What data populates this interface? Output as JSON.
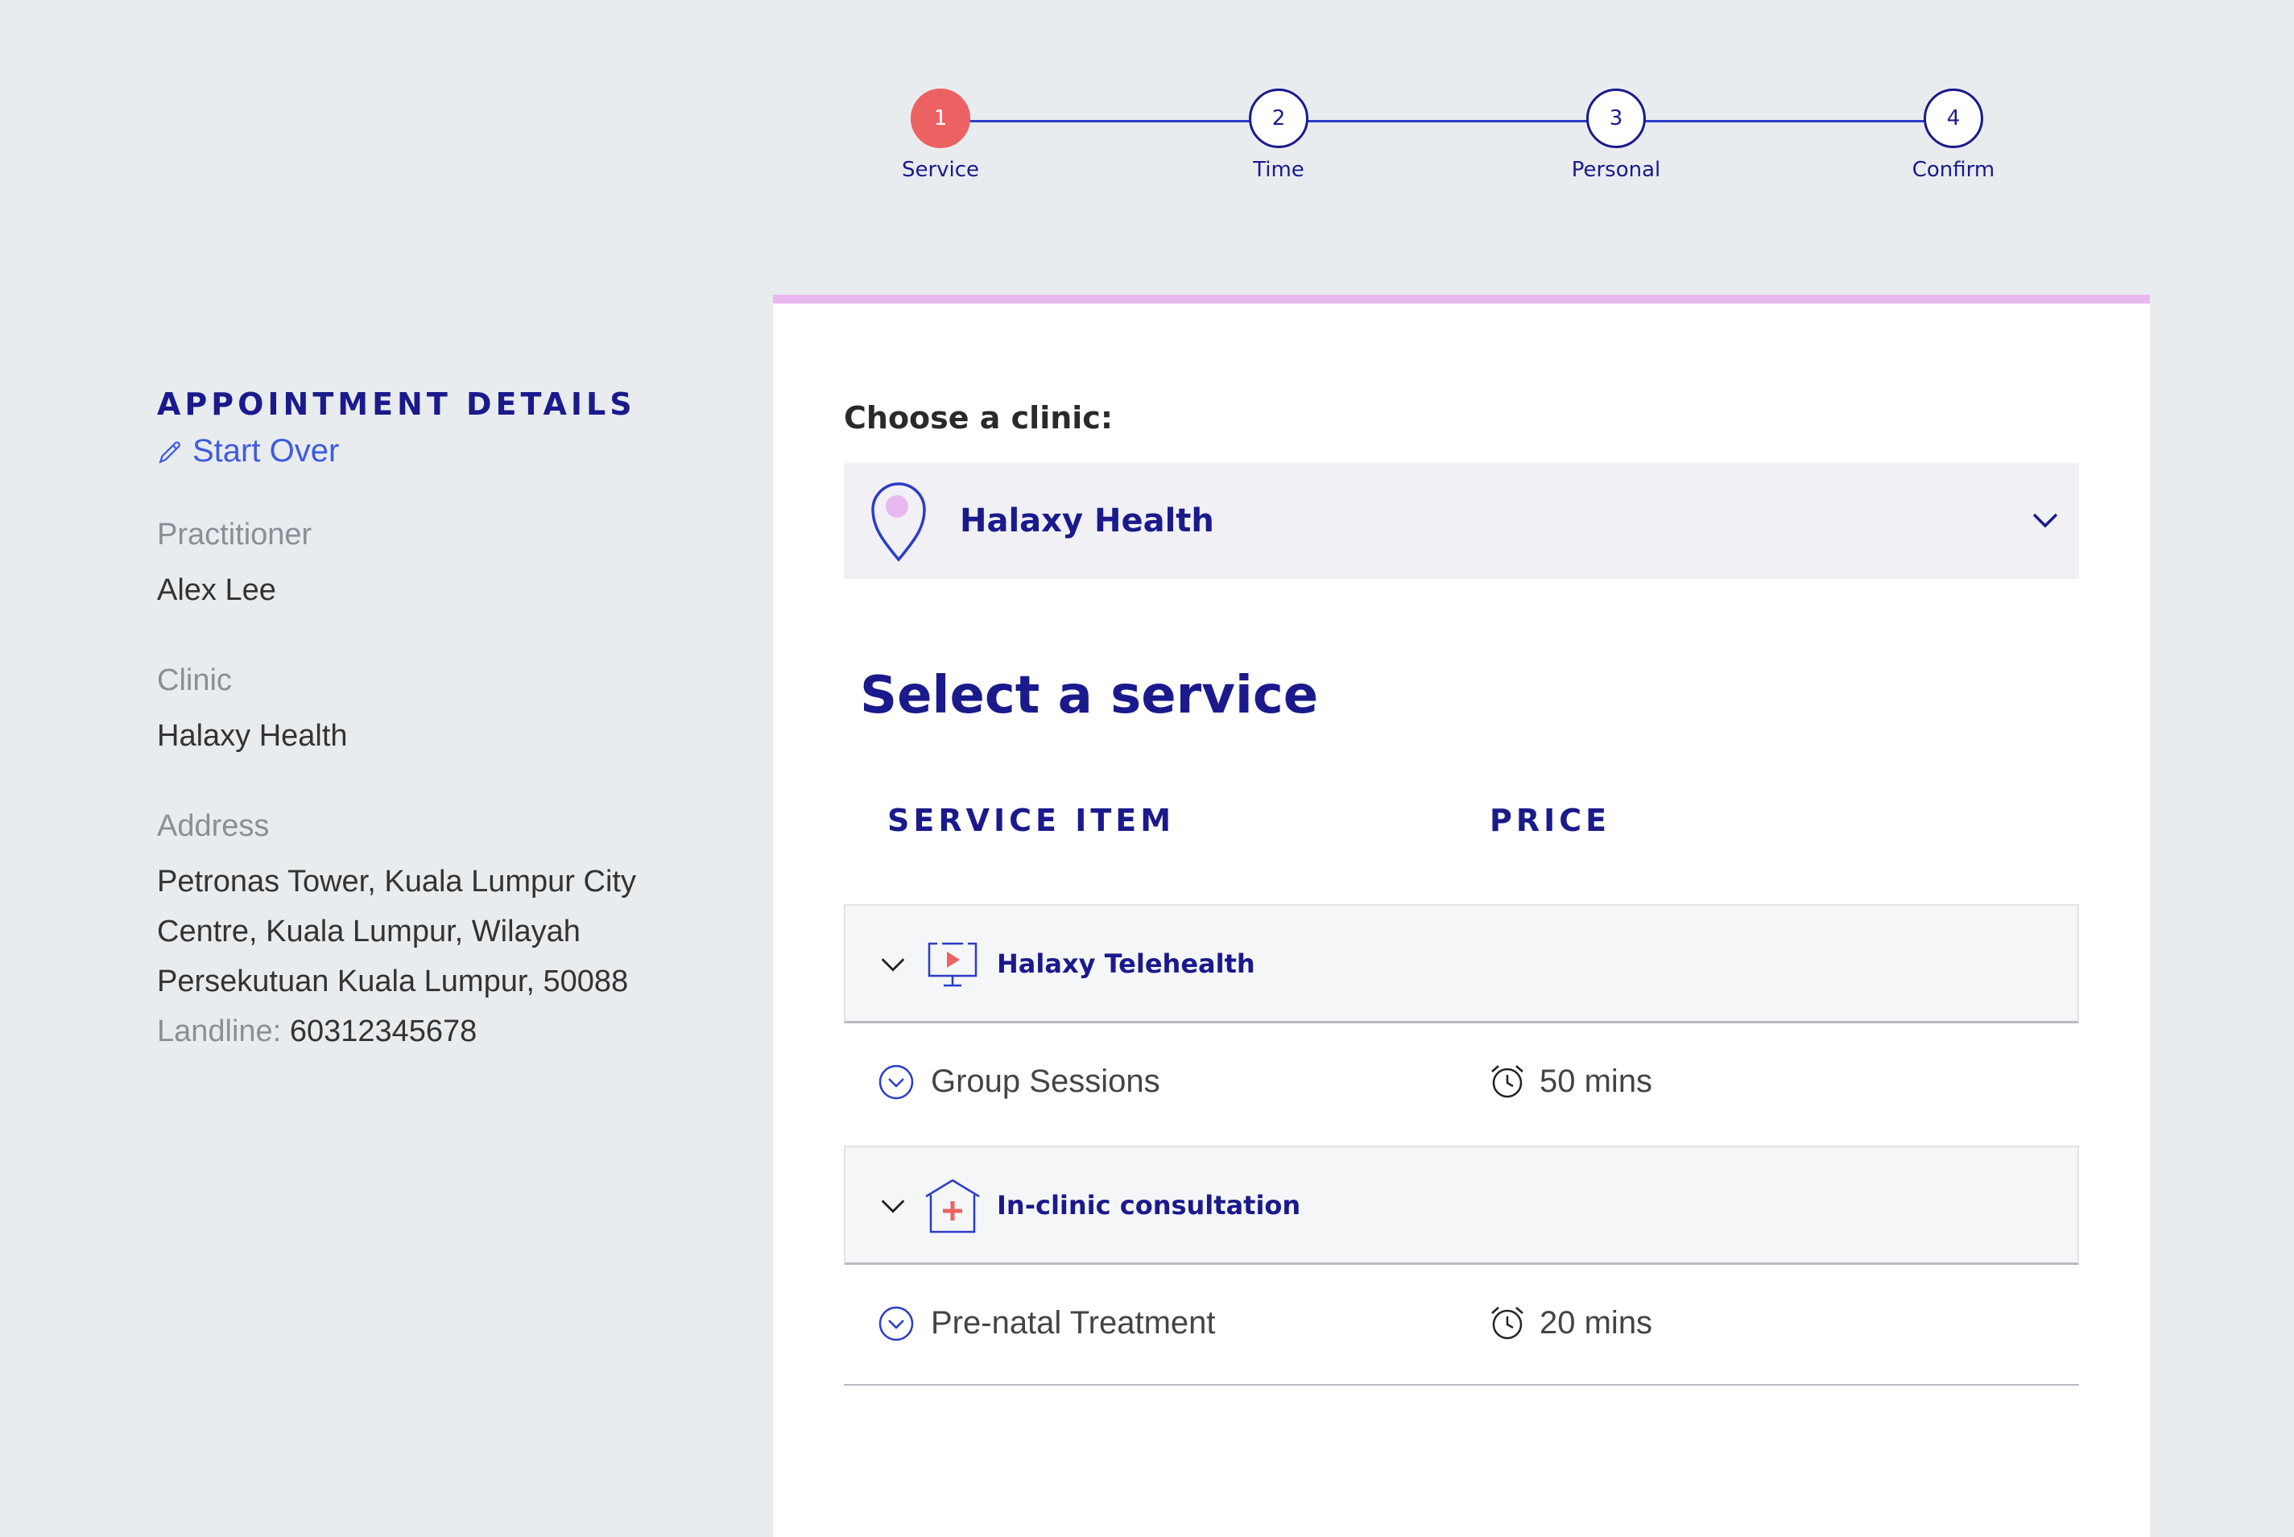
{
  "stepper": {
    "steps": [
      {
        "number": "1",
        "label": "Service"
      },
      {
        "number": "2",
        "label": "Time"
      },
      {
        "number": "3",
        "label": "Personal"
      },
      {
        "number": "4",
        "label": "Confirm"
      }
    ],
    "active_step": 1
  },
  "sidebar": {
    "title": "APPOINTMENT DETAILS",
    "start_over": "Start Over",
    "practitioner_label": "Practitioner",
    "practitioner_value": "Alex Lee",
    "clinic_label": "Clinic",
    "clinic_value": "Halaxy Health",
    "address_label": "Address",
    "address_lines": [
      "Petronas Tower, Kuala Lumpur City",
      "Centre, Kuala Lumpur, Wilayah",
      "Persekutuan Kuala Lumpur, 50088"
    ],
    "landline_label": "Landline:",
    "landline_value": "60312345678"
  },
  "clinic": {
    "label": "Choose a clinic:",
    "selected": "Halaxy Health"
  },
  "services": {
    "title": "Select a service",
    "col_item": "SERVICE ITEM",
    "col_price": "PRICE",
    "groups": [
      {
        "name": "Halaxy Telehealth",
        "icon": "telehealth-icon",
        "items": [
          {
            "name": "Group Sessions",
            "duration": "50 mins"
          }
        ]
      },
      {
        "name": "In-clinic consultation",
        "icon": "clinic-icon",
        "items": [
          {
            "name": "Pre-natal Treatment",
            "duration": "20 mins"
          }
        ]
      }
    ]
  },
  "colors": {
    "brand": "#1a1a8c",
    "accent": "#ec6262",
    "link": "#3d5be0",
    "card_top_border": "#e9b8f0"
  }
}
